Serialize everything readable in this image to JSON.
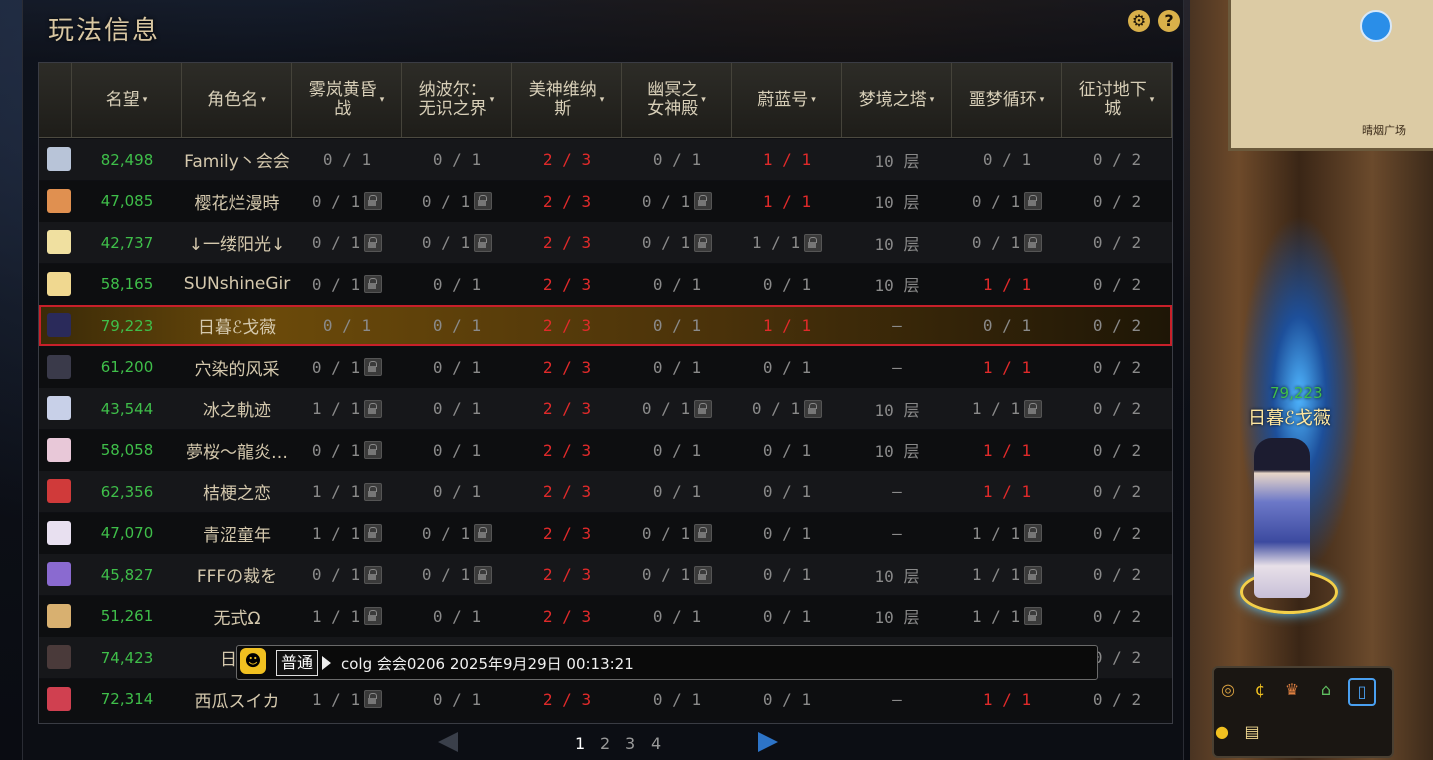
{
  "window": {
    "title": "玩法信息",
    "settings_icon": "gear-icon",
    "help_icon": "?"
  },
  "table": {
    "headers": [
      {
        "label": "",
        "sortable": false
      },
      {
        "label": "名望",
        "sortable": true
      },
      {
        "label": "角色名",
        "sortable": true
      },
      {
        "label": "雾岚黄昏\n战",
        "sortable": true
      },
      {
        "label": "纳波尔：\n无识之界",
        "sortable": true
      },
      {
        "label": "美神维纳\n斯",
        "sortable": true
      },
      {
        "label": "幽冥之\n女神殿",
        "sortable": true
      },
      {
        "label": "蔚蓝号",
        "sortable": true
      },
      {
        "label": "梦境之塔",
        "sortable": true
      },
      {
        "label": "噩梦循环",
        "sortable": true
      },
      {
        "label": "征讨地下\n城",
        "sortable": true
      }
    ],
    "rows": [
      {
        "avatar": "#b8c4d8",
        "fame": "82,498",
        "name": "Family丶会会",
        "c": [
          [
            "0 / 1",
            ""
          ],
          [
            "0 / 1",
            ""
          ],
          [
            "2 / 3",
            "red"
          ],
          [
            "0 / 1",
            ""
          ],
          [
            "1 / 1",
            "red"
          ],
          [
            "10 层",
            ""
          ],
          [
            "0 / 1",
            ""
          ],
          [
            "0 / 2",
            ""
          ]
        ],
        "locks": []
      },
      {
        "avatar": "#e09050",
        "fame": "47,085",
        "name": "樱花烂漫時",
        "c": [
          [
            "0 / 1",
            ""
          ],
          [
            "0 / 1",
            ""
          ],
          [
            "2 / 3",
            "red"
          ],
          [
            "0 / 1",
            ""
          ],
          [
            "1 / 1",
            "red"
          ],
          [
            "10 层",
            ""
          ],
          [
            "0 / 1",
            ""
          ],
          [
            "0 / 2",
            ""
          ]
        ],
        "locks": [
          0,
          1,
          3,
          6
        ]
      },
      {
        "avatar": "#f0e0a0",
        "fame": "42,737",
        "name": "↓一缕阳光↓",
        "c": [
          [
            "0 / 1",
            ""
          ],
          [
            "0 / 1",
            ""
          ],
          [
            "2 / 3",
            "red"
          ],
          [
            "0 / 1",
            ""
          ],
          [
            "1 / 1",
            ""
          ],
          [
            "10 层",
            ""
          ],
          [
            "0 / 1",
            ""
          ],
          [
            "0 / 2",
            ""
          ]
        ],
        "locks": [
          0,
          1,
          3,
          4,
          6
        ]
      },
      {
        "avatar": "#f0d890",
        "fame": "58,165",
        "name": "SUNshineGir",
        "c": [
          [
            "0 / 1",
            ""
          ],
          [
            "0 / 1",
            ""
          ],
          [
            "2 / 3",
            "red"
          ],
          [
            "0 / 1",
            ""
          ],
          [
            "0 / 1",
            ""
          ],
          [
            "10 层",
            ""
          ],
          [
            "1 / 1",
            "red"
          ],
          [
            "0 / 2",
            ""
          ]
        ],
        "locks": [
          0
        ]
      },
      {
        "avatar": "#2a2a5a",
        "fame": "79,223",
        "name": "日暮ℰ戈薇",
        "c": [
          [
            "0 / 1",
            ""
          ],
          [
            "0 / 1",
            ""
          ],
          [
            "2 / 3",
            "red"
          ],
          [
            "0 / 1",
            ""
          ],
          [
            "1 / 1",
            "red"
          ],
          [
            "–",
            ""
          ],
          [
            "0 / 1",
            ""
          ],
          [
            "0 / 2",
            ""
          ]
        ],
        "locks": [],
        "selected": true
      },
      {
        "avatar": "#3a3a4a",
        "fame": "61,200",
        "name": "穴染的风采",
        "c": [
          [
            "0 / 1",
            ""
          ],
          [
            "0 / 1",
            ""
          ],
          [
            "2 / 3",
            "red"
          ],
          [
            "0 / 1",
            ""
          ],
          [
            "0 / 1",
            ""
          ],
          [
            "–",
            ""
          ],
          [
            "1 / 1",
            "red"
          ],
          [
            "0 / 2",
            ""
          ]
        ],
        "locks": [
          0
        ]
      },
      {
        "avatar": "#c8d0e8",
        "fame": "43,544",
        "name": "冰之軌迹",
        "c": [
          [
            "1 / 1",
            ""
          ],
          [
            "0 / 1",
            ""
          ],
          [
            "2 / 3",
            "red"
          ],
          [
            "0 / 1",
            ""
          ],
          [
            "0 / 1",
            ""
          ],
          [
            "10 层",
            ""
          ],
          [
            "1 / 1",
            ""
          ],
          [
            "0 / 2",
            ""
          ]
        ],
        "locks": [
          0,
          3,
          4,
          6
        ]
      },
      {
        "avatar": "#e8c8d8",
        "fame": "58,058",
        "name": "夢桜～龍炎…",
        "c": [
          [
            "0 / 1",
            ""
          ],
          [
            "0 / 1",
            ""
          ],
          [
            "2 / 3",
            "red"
          ],
          [
            "0 / 1",
            ""
          ],
          [
            "0 / 1",
            ""
          ],
          [
            "10 层",
            ""
          ],
          [
            "1 / 1",
            "red"
          ],
          [
            "0 / 2",
            ""
          ]
        ],
        "locks": [
          0
        ]
      },
      {
        "avatar": "#d03a3a",
        "fame": "62,356",
        "name": "桔梗之恋",
        "c": [
          [
            "1 / 1",
            ""
          ],
          [
            "0 / 1",
            ""
          ],
          [
            "2 / 3",
            "red"
          ],
          [
            "0 / 1",
            ""
          ],
          [
            "0 / 1",
            ""
          ],
          [
            "–",
            ""
          ],
          [
            "1 / 1",
            "red"
          ],
          [
            "0 / 2",
            ""
          ]
        ],
        "locks": [
          0
        ]
      },
      {
        "avatar": "#e8e0f0",
        "fame": "47,070",
        "name": "青涩童年",
        "c": [
          [
            "1 / 1",
            ""
          ],
          [
            "0 / 1",
            ""
          ],
          [
            "2 / 3",
            "red"
          ],
          [
            "0 / 1",
            ""
          ],
          [
            "0 / 1",
            ""
          ],
          [
            "–",
            ""
          ],
          [
            "1 / 1",
            ""
          ],
          [
            "0 / 2",
            ""
          ]
        ],
        "locks": [
          0,
          1,
          3,
          6
        ]
      },
      {
        "avatar": "#8a6ad0",
        "fame": "45,827",
        "name": "FFFの裁を",
        "c": [
          [
            "0 / 1",
            ""
          ],
          [
            "0 / 1",
            ""
          ],
          [
            "2 / 3",
            "red"
          ],
          [
            "0 / 1",
            ""
          ],
          [
            "0 / 1",
            ""
          ],
          [
            "10 层",
            ""
          ],
          [
            "1 / 1",
            ""
          ],
          [
            "0 / 2",
            ""
          ]
        ],
        "locks": [
          0,
          1,
          3,
          6
        ]
      },
      {
        "avatar": "#d8b070",
        "fame": "51,261",
        "name": "无式Ω",
        "c": [
          [
            "1 / 1",
            ""
          ],
          [
            "0 / 1",
            ""
          ],
          [
            "2 / 3",
            "red"
          ],
          [
            "0 / 1",
            ""
          ],
          [
            "0 / 1",
            ""
          ],
          [
            "10 层",
            ""
          ],
          [
            "1 / 1",
            ""
          ],
          [
            "0 / 2",
            ""
          ]
        ],
        "locks": [
          0,
          6
        ]
      },
      {
        "avatar": "#4a3a3a",
        "fame": "74,423",
        "name": "日淵",
        "c": [
          [
            "",
            ""
          ],
          [
            "",
            ""
          ],
          [
            "",
            ""
          ],
          [
            "",
            ""
          ],
          [
            "",
            ""
          ],
          [
            "",
            ""
          ],
          [
            "",
            ""
          ],
          [
            "0 / 2",
            ""
          ]
        ],
        "locks": []
      },
      {
        "avatar": "#d04050",
        "fame": "72,314",
        "name": "西瓜スイカ",
        "c": [
          [
            "1 / 1",
            ""
          ],
          [
            "0 / 1",
            ""
          ],
          [
            "2 / 3",
            "red"
          ],
          [
            "0 / 1",
            ""
          ],
          [
            "0 / 1",
            ""
          ],
          [
            "–",
            ""
          ],
          [
            "1 / 1",
            "red"
          ],
          [
            "0 / 2",
            ""
          ]
        ],
        "locks": [
          0
        ]
      }
    ]
  },
  "chat": {
    "channel": "普通",
    "message": "colg 会会0206  2025年9月29日 00:13:21"
  },
  "pager": {
    "pages": [
      "1",
      "2",
      "3",
      "4"
    ],
    "current": "1"
  },
  "scene": {
    "map_label": "晴烟广场",
    "character_fame": "79,223",
    "character_name": "日暮ℰ戈薇"
  },
  "colors": {
    "fame_green": "#3fbf4a",
    "red_value": "#e02a2a",
    "selection_border": "#c8202a",
    "accent_gold": "#d9b04a"
  }
}
